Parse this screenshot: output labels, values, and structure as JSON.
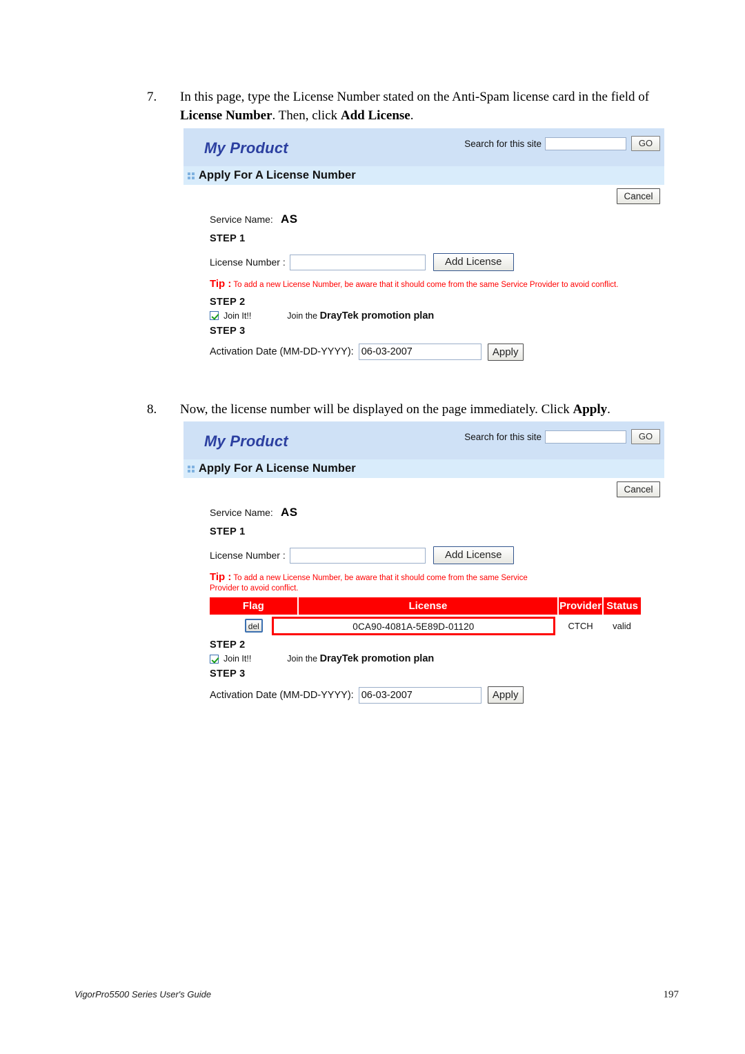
{
  "document": {
    "steps": [
      {
        "number": "7.",
        "text_parts": [
          {
            "t": "In this page, type the License Number stated on the Anti-Spam license card in the field of ",
            "b": false
          },
          {
            "t": "License Number",
            "b": true
          },
          {
            "t": ". Then, click ",
            "b": false
          },
          {
            "t": "Add License",
            "b": true
          },
          {
            "t": ".",
            "b": false
          }
        ]
      },
      {
        "number": "8.",
        "text_parts": [
          {
            "t": "Now, the license number will be displayed on the page immediately. Click ",
            "b": false
          },
          {
            "t": "Apply",
            "b": true
          },
          {
            "t": ".",
            "b": false
          }
        ]
      }
    ],
    "footer": {
      "left": "VigorPro5500 Series User's Guide",
      "page_number": "197"
    }
  },
  "panel_1": {
    "brand": "My Product",
    "search": {
      "label": "Search for this site",
      "value": "",
      "placeholder": "",
      "go_label": "GO"
    },
    "title": "Apply For A License Number",
    "cancel_label": "Cancel",
    "service_name_label": "Service Name:",
    "service_name_value": "AS",
    "step1_label": "STEP 1",
    "license_number_label": "License Number :",
    "license_number_value": "",
    "add_license_label": "Add License",
    "tip_word": "Tip :",
    "tip_text": " To add a new License Number, be aware that it should come from the same Service Provider to avoid conflict.",
    "step2_label": "STEP 2",
    "join_checkbox_label": "Join It!!",
    "join_checked": true,
    "promo_prefix": "Join the ",
    "promo_strong": "DrayTek promotion plan",
    "step3_label": "STEP 3",
    "activation_label": "Activation Date (MM-DD-YYYY):",
    "activation_value": "06-03-2007",
    "apply_label": "Apply",
    "has_table": false
  },
  "panel_2": {
    "brand": "My Product",
    "search": {
      "label": "Search for this site",
      "value": "",
      "placeholder": "",
      "go_label": "GO"
    },
    "title": "Apply For A License Number",
    "cancel_label": "Cancel",
    "service_name_label": "Service Name:",
    "service_name_value": "AS",
    "step1_label": "STEP 1",
    "license_number_label": "License Number :",
    "license_number_value": "",
    "add_license_label": "Add License",
    "tip_word": "Tip :",
    "tip_text": " To add a new License Number, be aware that it should come from the same Service Provider to avoid conflict.",
    "step2_label": "STEP 2",
    "join_checkbox_label": "Join It!!",
    "join_checked": true,
    "promo_prefix": "Join the ",
    "promo_strong": "DrayTek promotion plan",
    "step3_label": "STEP 3",
    "activation_label": "Activation Date (MM-DD-YYYY):",
    "activation_value": "06-03-2007",
    "apply_label": "Apply",
    "has_table": true,
    "table": {
      "headers": [
        "Flag",
        "License",
        "Provider",
        "Status"
      ],
      "rows": [
        {
          "flag_button": "del",
          "license": "0CA90-4081A-5E89D-01120",
          "provider": "CTCH",
          "status": "valid"
        }
      ]
    }
  },
  "colors": {
    "header_blue": "#cfe1f6",
    "title_blue": "#d9ecfb",
    "brand_blue": "#2b3fa0",
    "tip_red": "#ff0000",
    "table_red": "#fe0000",
    "check_green": "#1a9e1a"
  }
}
